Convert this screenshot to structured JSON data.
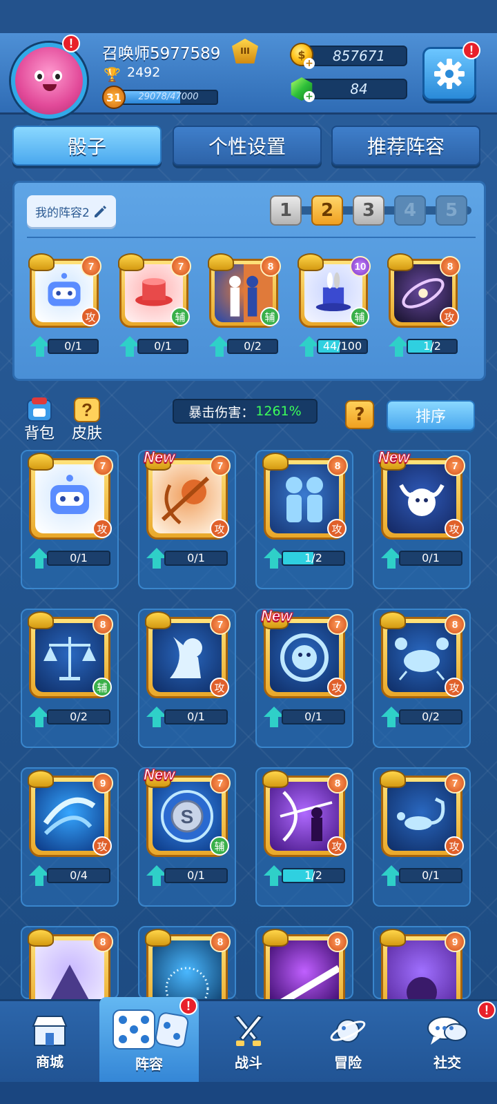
{
  "header": {
    "player_name": "召唤师5977589",
    "trophies": "2492",
    "level": "31",
    "xp_text": "29078/47000",
    "xp_fraction": 0.62,
    "rank_badge": "III",
    "gold": "857671",
    "gems": "84",
    "avatar_alert": "!",
    "settings_alert": "!"
  },
  "tabs": [
    {
      "label": "骰子",
      "active": true
    },
    {
      "label": "个性设置",
      "active": false
    },
    {
      "label": "推荐阵容",
      "active": false
    }
  ],
  "deck": {
    "name": "我的阵容2",
    "slots": [
      "1",
      "2",
      "3",
      "4",
      "5"
    ],
    "active_slot": "2",
    "cards": [
      {
        "icon": "robot-icon",
        "level": "7",
        "role": "攻",
        "progress": "0/1",
        "fill": 0.0
      },
      {
        "icon": "red-pedestal-icon",
        "level": "7",
        "role": "辅",
        "progress": "0/1",
        "fill": 0.0
      },
      {
        "icon": "silhouettes-icon",
        "level": "8",
        "role": "辅",
        "progress": "0/2",
        "fill": 0.0
      },
      {
        "icon": "magic-hat-icon",
        "level": "10",
        "role": "辅",
        "progress": "44/100",
        "fill": 0.44
      },
      {
        "icon": "galaxy-icon",
        "level": "8",
        "role": "攻",
        "progress": "1/2",
        "fill": 0.5
      }
    ]
  },
  "toolbar": {
    "backpack_label": "背包",
    "skin_label": "皮肤",
    "crit_label": "暴击伤害：",
    "crit_value": "1261%",
    "help_label": "?",
    "sort_label": "排序"
  },
  "collection": [
    {
      "icon": "robot-icon",
      "level": "7",
      "role": "攻",
      "progress": "0/1",
      "fill": 0.0,
      "new": false
    },
    {
      "icon": "sagittarius-icon",
      "level": "7",
      "role": "攻",
      "progress": "0/1",
      "fill": 0.0,
      "new": true
    },
    {
      "icon": "gemini-icon",
      "level": "8",
      "role": "攻",
      "progress": "1/2",
      "fill": 0.5,
      "new": false
    },
    {
      "icon": "taurus-icon",
      "level": "7",
      "role": "攻",
      "progress": "0/1",
      "fill": 0.0,
      "new": true
    },
    {
      "icon": "libra-icon",
      "level": "8",
      "role": "辅",
      "progress": "0/2",
      "fill": 0.0,
      "new": false
    },
    {
      "icon": "virgo-icon",
      "level": "7",
      "role": "攻",
      "progress": "0/1",
      "fill": 0.0,
      "new": false
    },
    {
      "icon": "leo-icon",
      "level": "7",
      "role": "攻",
      "progress": "0/1",
      "fill": 0.0,
      "new": true
    },
    {
      "icon": "cancer-icon",
      "level": "8",
      "role": "攻",
      "progress": "0/2",
      "fill": 0.0,
      "new": false
    },
    {
      "icon": "whirlwind-icon",
      "level": "9",
      "role": "攻",
      "progress": "0/4",
      "fill": 0.0,
      "new": false
    },
    {
      "icon": "target-coin-icon",
      "level": "7",
      "role": "辅",
      "progress": "0/1",
      "fill": 0.0,
      "new": true
    },
    {
      "icon": "archer-icon",
      "level": "8",
      "role": "攻",
      "progress": "1/2",
      "fill": 0.5,
      "new": false
    },
    {
      "icon": "scorpio-icon",
      "level": "7",
      "role": "攻",
      "progress": "0/1",
      "fill": 0.0,
      "new": false
    },
    {
      "icon": "witch-icon",
      "level": "8",
      "role": "",
      "progress": "",
      "fill": 0.0,
      "new": false
    },
    {
      "icon": "firework-icon",
      "level": "8",
      "role": "",
      "progress": "",
      "fill": 0.0,
      "new": false
    },
    {
      "icon": "purple-beam-icon",
      "level": "9",
      "role": "",
      "progress": "",
      "fill": 0.0,
      "new": false
    },
    {
      "icon": "purple-creature-icon",
      "level": "9",
      "role": "",
      "progress": "",
      "fill": 0.0,
      "new": false
    }
  ],
  "new_label": "New",
  "bottom_nav": [
    {
      "label": "商城",
      "icon": "shop-icon",
      "active": false
    },
    {
      "label": "阵容",
      "icon": "dice-icon",
      "active": true,
      "alert": "!"
    },
    {
      "label": "战斗",
      "icon": "swords-icon",
      "active": false
    },
    {
      "label": "冒险",
      "icon": "planet-icon",
      "active": false
    },
    {
      "label": "社交",
      "icon": "chat-icon",
      "active": false,
      "alert": "!"
    }
  ],
  "colors": {
    "art_themes": {
      "robot-icon": [
        "#ffffff",
        "#cfe6ff"
      ],
      "red-pedestal-icon": [
        "#fff0f0",
        "#ffb0b0"
      ],
      "silhouettes-icon": [
        "#2c4aa8",
        "#e07a3a"
      ],
      "magic-hat-icon": [
        "#f2f4ff",
        "#c8d4ff"
      ],
      "galaxy-icon": [
        "#1a1430",
        "#6a4aa0"
      ],
      "sagittarius-icon": [
        "#fff2e0",
        "#f0a060"
      ],
      "gemini-icon": [
        "#183a7a",
        "#3a7ad0"
      ],
      "taurus-icon": [
        "#152a66",
        "#2f5ab8"
      ],
      "libra-icon": [
        "#10306a",
        "#2a68c0"
      ],
      "virgo-icon": [
        "#10306a",
        "#2a68c0"
      ],
      "leo-icon": [
        "#10306a",
        "#2a68c0"
      ],
      "cancer-icon": [
        "#10306a",
        "#2a68c0"
      ],
      "whirlwind-icon": [
        "#0e3d8a",
        "#36a6ff"
      ],
      "target-coin-icon": [
        "#0e3d8a",
        "#3a8cf0"
      ],
      "archer-icon": [
        "#4a1a8a",
        "#b06aff"
      ],
      "scorpio-icon": [
        "#10306a",
        "#2a68c0"
      ],
      "witch-icon": [
        "#f0ecff",
        "#c8b8ff"
      ],
      "firework-icon": [
        "#0e3d6a",
        "#4ab8ff"
      ],
      "purple-beam-icon": [
        "#3a0a6a",
        "#c060ff"
      ],
      "purple-creature-icon": [
        "#5a2aa0",
        "#a070ff"
      ]
    }
  }
}
